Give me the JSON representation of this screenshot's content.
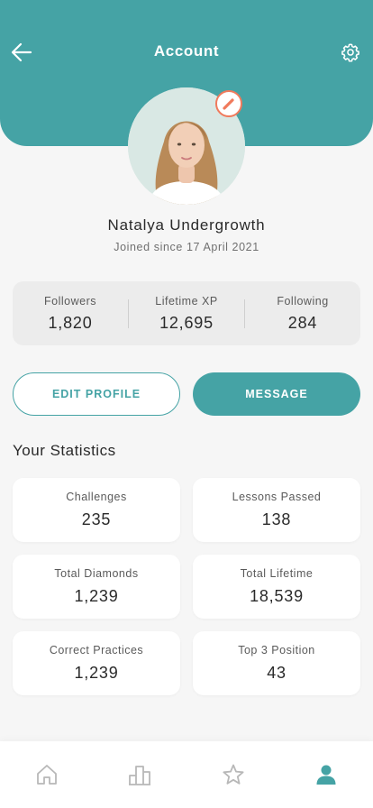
{
  "header": {
    "title": "Account",
    "background_color": "#45a3a5",
    "back_icon": "arrow-left-icon",
    "settings_icon": "gear-icon"
  },
  "profile": {
    "name": "Natalya Undergrowth",
    "joined": "Joined since 17 April 2021",
    "edit_avatar_icon": "pencil-icon",
    "edit_badge_color": "#f07a5c"
  },
  "summary": [
    {
      "label": "Followers",
      "value": "1,820"
    },
    {
      "label": "Lifetime XP",
      "value": "12,695"
    },
    {
      "label": "Following",
      "value": "284"
    }
  ],
  "actions": {
    "edit_profile": "EDIT PROFILE",
    "message": "MESSAGE"
  },
  "statistics": {
    "title": "Your Statistics",
    "items": [
      {
        "label": "Challenges",
        "value": "235"
      },
      {
        "label": "Lessons Passed",
        "value": "138"
      },
      {
        "label": "Total Diamonds",
        "value": "1,239"
      },
      {
        "label": "Total Lifetime",
        "value": "18,539"
      },
      {
        "label": "Correct Practices",
        "value": "1,239"
      },
      {
        "label": "Top 3 Position",
        "value": "43"
      }
    ]
  },
  "bottom_nav": {
    "items": [
      {
        "icon": "home-icon",
        "active": false
      },
      {
        "icon": "leaderboard-icon",
        "active": false
      },
      {
        "icon": "star-icon",
        "active": false
      },
      {
        "icon": "profile-icon",
        "active": true
      }
    ],
    "active_color": "#45a3a5",
    "inactive_color": "#b8b8b8"
  }
}
